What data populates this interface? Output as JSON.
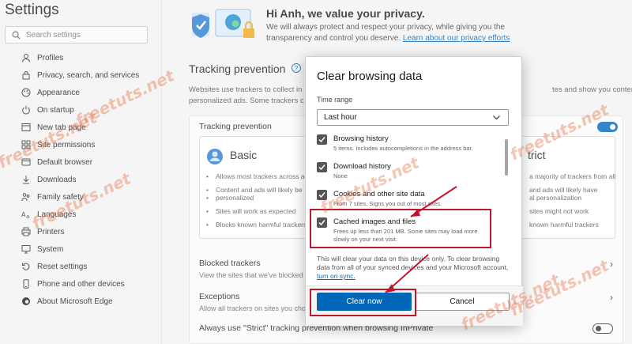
{
  "sidebar": {
    "title": "Settings",
    "search_placeholder": "Search settings",
    "items": [
      {
        "label": "Profiles",
        "icon": "profile-icon"
      },
      {
        "label": "Privacy, search, and services",
        "icon": "lock-icon"
      },
      {
        "label": "Appearance",
        "icon": "appearance-icon"
      },
      {
        "label": "On startup",
        "icon": "power-icon"
      },
      {
        "label": "New tab page",
        "icon": "new-tab-icon"
      },
      {
        "label": "Site permissions",
        "icon": "permissions-icon"
      },
      {
        "label": "Default browser",
        "icon": "browser-icon"
      },
      {
        "label": "Downloads",
        "icon": "download-icon"
      },
      {
        "label": "Family safety",
        "icon": "family-icon"
      },
      {
        "label": "Languages",
        "icon": "language-icon"
      },
      {
        "label": "Printers",
        "icon": "printer-icon"
      },
      {
        "label": "System",
        "icon": "system-icon"
      },
      {
        "label": "Reset settings",
        "icon": "reset-icon"
      },
      {
        "label": "Phone and other devices",
        "icon": "phone-icon"
      },
      {
        "label": "About Microsoft Edge",
        "icon": "edge-icon"
      }
    ]
  },
  "main": {
    "hero_title": "Hi Anh, we value your privacy.",
    "hero_text": "We will always protect and respect your privacy, while giving you the transparency and control you deserve.",
    "hero_link": "Learn about our privacy efforts",
    "tracking_title": "Tracking prevention",
    "tracking_desc_left": "Websites use trackers to collect in",
    "tracking_desc_left2": "personalized ads. Some trackers c",
    "tracking_desc_right": "tes and show you content like",
    "panel_head": "Tracking prevention",
    "basic": {
      "title": "Basic",
      "bullets": [
        "Allows most trackers across all",
        "Content and ads will likely be",
        "personalized",
        "Sites will work as expected",
        "Blocks known harmful trackers"
      ]
    },
    "strict": {
      "title": "trict",
      "bullets": [
        "a majority of trackers from all",
        "and ads will likely have",
        "al personalization",
        "sites might not work",
        "known harmful trackers"
      ]
    },
    "blocked_title": "Blocked trackers",
    "blocked_desc": "View the sites that we've blocked fro",
    "exceptions_title": "Exceptions",
    "exceptions_desc": "Allow all trackers on sites you choose",
    "strict_private": "Always use \"Strict\" tracking prevention when browsing InPrivate"
  },
  "dialog": {
    "title": "Clear browsing data",
    "time_range_label": "Time range",
    "time_range_value": "Last hour",
    "items": [
      {
        "label": "Browsing history",
        "desc": "5 items. Includes autocompletions in the address bar.",
        "checked": true
      },
      {
        "label": "Download history",
        "desc": "None",
        "checked": true
      },
      {
        "label": "Cookies and other site data",
        "desc": "From 7 sites. Signs you out of most sites.",
        "checked": true
      },
      {
        "label": "Cached images and files",
        "desc": "Frees up less than 201 MB. Some sites may load more slowly on your next visit.",
        "checked": true
      }
    ],
    "note": "This will clear your data on this device only. To clear browsing data from all of your synced devices and your Microsoft account,",
    "note_link": "turn on sync.",
    "clear_button": "Clear now",
    "cancel_button": "Cancel"
  },
  "watermark": "freetuts.net",
  "colors": {
    "accent": "#0067b8",
    "highlight": "#c0152a",
    "watermark": "#e16937"
  }
}
